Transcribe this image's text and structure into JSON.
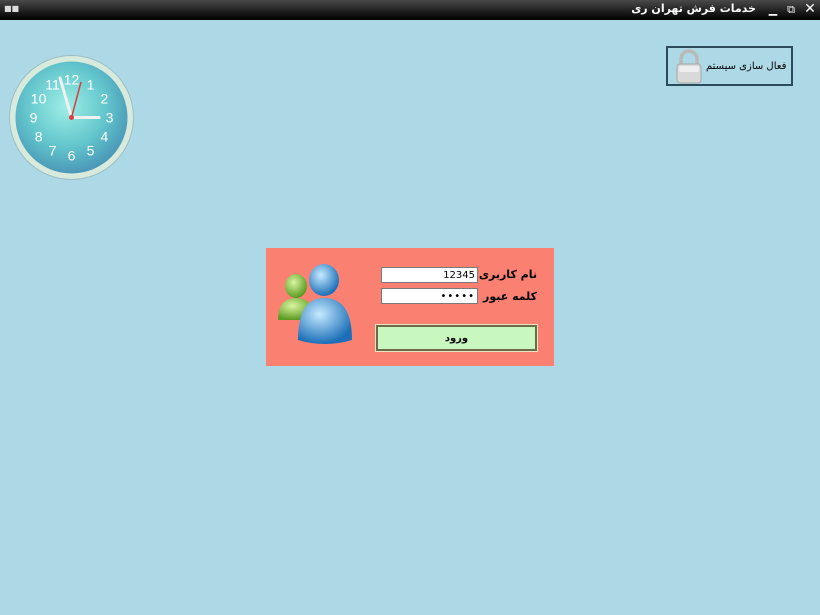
{
  "window": {
    "title": "خدمات فرش تهران ری",
    "system_icon": "app-icon",
    "minimize": "minimize-icon",
    "restore": "restore-icon",
    "close": "close-icon"
  },
  "clock": {
    "numbers": [
      "12",
      "1",
      "2",
      "3",
      "4",
      "5",
      "6",
      "7",
      "8",
      "9",
      "10",
      "11"
    ],
    "colors": {
      "face": "#5fc9c9",
      "rim": "#e9f4d8"
    }
  },
  "activate": {
    "label": "فعال سازی سیستم",
    "icon": "lock-icon"
  },
  "login": {
    "username_label": "نام کاربری",
    "password_label": "کلمه عبور",
    "username_value": "12345",
    "password_value": "12345",
    "submit_label": "ورود",
    "icon": "users-icon",
    "colors": {
      "panel": "#fa8072",
      "button": "#c8f7c0"
    }
  }
}
